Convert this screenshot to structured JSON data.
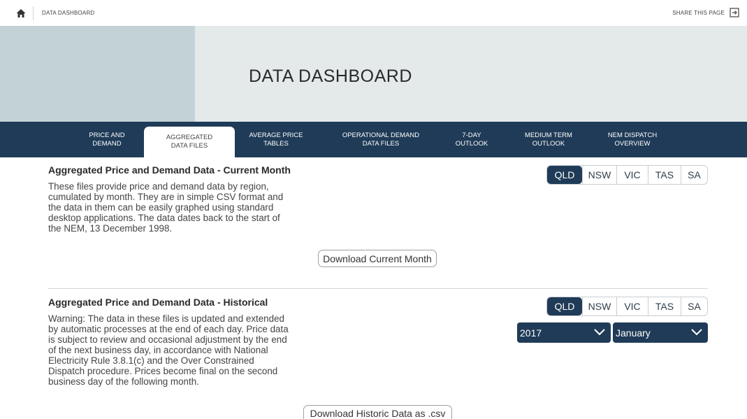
{
  "topbar": {
    "breadcrumb": "DATA DASHBOARD",
    "share_label": "SHARE THIS PAGE"
  },
  "hero": {
    "title": "DATA DASHBOARD"
  },
  "nav": {
    "tabs": [
      {
        "label": "PRICE AND\nDEMAND"
      },
      {
        "label": "AGGREGATED\nDATA FILES",
        "active": true
      },
      {
        "label": "AVERAGE PRICE\nTABLES"
      },
      {
        "label": "OPERATIONAL DEMAND\nDATA FILES"
      },
      {
        "label": "7-DAY\nOUTLOOK"
      },
      {
        "label": "MEDIUM TERM\nOUTLOOK"
      },
      {
        "label": "NEM DISPATCH\nOVERVIEW"
      }
    ]
  },
  "current": {
    "title": "Aggregated Price and Demand Data - Current Month",
    "body_lines": [
      "These files provide price and demand data by region,",
      "cumulated by month. They are in simple CSV format and",
      "the data in them can be easily graphed using standard",
      "desktop applications. The data dates back to the start of",
      "the NEM, 13 December 1998."
    ],
    "regions": [
      "QLD",
      "NSW",
      "VIC",
      "TAS",
      "SA"
    ],
    "selected_region": "QLD",
    "download_label": "Download Current Month"
  },
  "historical": {
    "title": "Aggregated Price and Demand Data - Historical",
    "body_lines": [
      "Warning: The data in these files is updated and extended",
      "by automatic processes at the end of each day. Price data",
      "is subject to review and occasional adjustment by the end",
      "of the next business day, in accordance with National",
      "Electricity Rule 3.8.1(c) and the Over Constrained",
      "Dispatch procedure. Prices become final on the second",
      "business day of the following month."
    ],
    "regions": [
      "QLD",
      "NSW",
      "VIC",
      "TAS",
      "SA"
    ],
    "selected_region": "QLD",
    "year_value": "2017",
    "month_value": "January",
    "download_label": "Download Historic Data as .csv"
  },
  "icons": {
    "home": "home-icon",
    "share": "share-icon",
    "chevron": "chevron-down-icon"
  },
  "colors": {
    "navy": "#1f3b57",
    "hero_bg": "#e4e9ea",
    "hero_block": "#c3d2d7"
  }
}
